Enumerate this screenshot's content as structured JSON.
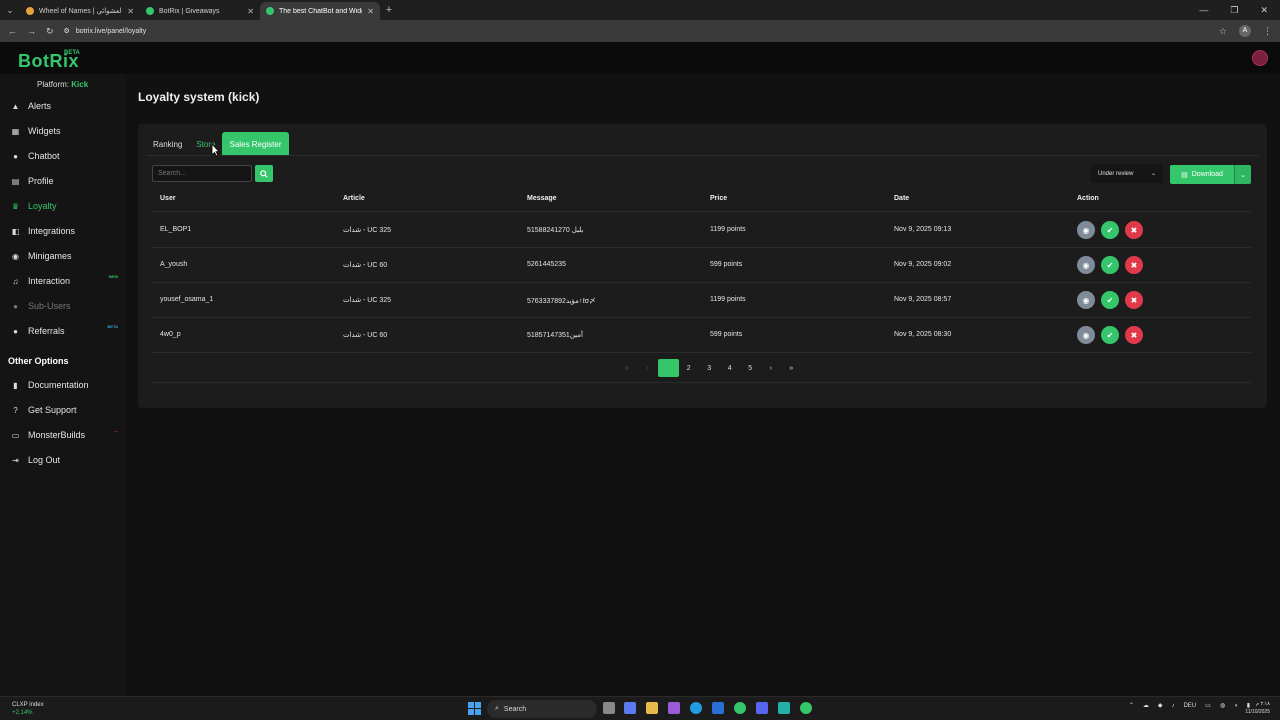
{
  "browser": {
    "tabs": [
      {
        "title": "Wheel of Names | عجلة الأسماء العشوائي"
      },
      {
        "title": "BotRix | Giveaways"
      },
      {
        "title": "The best ChatBot and Widgets"
      }
    ],
    "url": "botrix.live/panel/loyalty",
    "profile_initial": "A"
  },
  "app": {
    "logo": "BotRix",
    "logo_badge": "BETA",
    "platform_label": "Platform:",
    "platform_value": "Kick"
  },
  "sidebar": {
    "items": [
      {
        "label": "Alerts",
        "icon": "warning-icon"
      },
      {
        "label": "Widgets",
        "icon": "widgets-icon"
      },
      {
        "label": "Chatbot",
        "icon": "chat-icon"
      },
      {
        "label": "Profile",
        "icon": "profile-card-icon"
      },
      {
        "label": "Loyalty",
        "icon": "trophy-icon",
        "active": true
      },
      {
        "label": "Integrations",
        "icon": "puzzle-icon"
      },
      {
        "label": "Minigames",
        "icon": "gamepad-icon"
      },
      {
        "label": "Interaction",
        "icon": "music-icon",
        "tag": "NEW"
      },
      {
        "label": "Sub-Users",
        "icon": "users-icon",
        "disabled": true
      },
      {
        "label": "Referrals",
        "icon": "users-icon",
        "tag": "BETA"
      }
    ],
    "other_title": "Other Options",
    "other_items": [
      {
        "label": "Documentation",
        "icon": "book-icon"
      },
      {
        "label": "Get Support",
        "icon": "help-icon"
      },
      {
        "label": "MonsterBuilds",
        "icon": "monitor-icon"
      },
      {
        "label": "Log Out",
        "icon": "logout-icon"
      }
    ]
  },
  "main": {
    "title": "Loyalty system (kick)",
    "tabs": [
      "Ranking",
      "Store",
      "Sales Register"
    ],
    "search_placeholder": "Search...",
    "filter_value": "Under review",
    "download_label": "Download",
    "columns": [
      "User",
      "Article",
      "Message",
      "Price",
      "Date",
      "Action"
    ],
    "rows": [
      {
        "user": "EL_BOP1",
        "article": "شدات - UC 325",
        "message": "بلبل 51588241270",
        "price": "1199 points",
        "date": "Nov 9, 2025 09:13"
      },
      {
        "user": "A_yoush",
        "article": "شدات - UC 60",
        "message": "5261445235",
        "price": "599 points",
        "date": "Nov 9, 2025 09:02"
      },
      {
        "user": "yousef_osama_1",
        "article": "شدات - UC 325",
        "message": "5763337892مؤيد↑ℓσ〆",
        "price": "1199 points",
        "date": "Nov 9, 2025 08:57"
      },
      {
        "user": "4w0_p",
        "article": "شدات - UC 60",
        "message": "51857147351آمين",
        "price": "599 points",
        "date": "Nov 9, 2025 08:30"
      }
    ],
    "pagination": {
      "pages": [
        "1",
        "2",
        "3",
        "4",
        "5"
      ],
      "current": 1
    }
  },
  "taskbar": {
    "weather_title": "CLXP index",
    "weather_value": "+2,14%",
    "search_label": "Search",
    "lang": "DEU",
    "time": "٢:١٨ م",
    "date": "11/10/2025"
  },
  "colors": {
    "accent": "#35c66b",
    "danger": "#e03a4a",
    "neutral": "#7f8b99"
  }
}
